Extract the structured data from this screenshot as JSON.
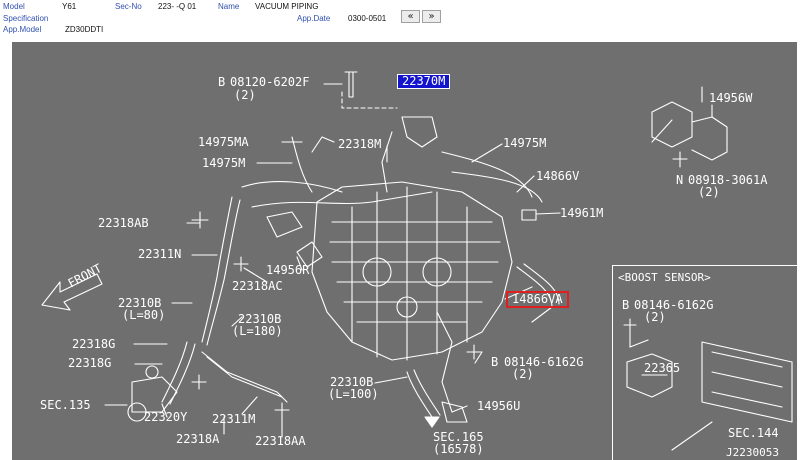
{
  "header": {
    "model_label": "Model",
    "model_value": "Y61",
    "secno_label": "Sec-No",
    "secno_value": "223-   -Q 01",
    "name_label": "Name",
    "name_value": "VACUUM PIPING",
    "spec_label": "Specification",
    "appdate_label": "App.Date",
    "appdate_value": "0300-0501",
    "appmodel_label": "App.Model",
    "appmodel_value": "ZD30DDTI",
    "prev_label": "«",
    "next_label": "»"
  },
  "diagram": {
    "labels": {
      "bolt_08120": "08120-6202F",
      "bolt_08120_qty": "(2)",
      "p22370m": "22370M",
      "p14975ma": "14975MA",
      "p22318m": "22318M",
      "p14975m_a": "14975M",
      "p14975m_b": "14975M",
      "p14866v": "14866V",
      "p14956w": "14956W",
      "nut_08918": "08918-3061A",
      "nut_08918_qty": "(2)",
      "p22318ab": "22318AB",
      "p14961m": "14961M",
      "p22311n": "22311N",
      "p14956r": "14956R",
      "p22318ac": "22318AC",
      "front": "FRONT",
      "p22310b_a": "22310B",
      "p22310b_a_len": "(L=80)",
      "p22310b_b": "22310B",
      "p22310b_b_len": "(L=180)",
      "p14866va": "14866VA",
      "boost_title": "<BOOST SENSOR>",
      "bolt_08146_a": "08146-6162G",
      "bolt_08146_a_qty": "(2)",
      "p22318g_a": "22318G",
      "p22318g_b": "22318G",
      "bolt_08146_b": "08146-6162G",
      "bolt_08146_b_qty": "(2)",
      "p22365": "22365",
      "p22310b_c": "22310B",
      "p22310b_c_len": "(L=100)",
      "sec135": "SEC.135",
      "p22320y": "22320Y",
      "p22311m": "22311M",
      "p14956u": "14956U",
      "p22318a": "22318A",
      "p22318aa": "22318AA",
      "sec165": "SEC.165",
      "sec165_ref": "(16578)",
      "sec144": "SEC.144",
      "drawing_no": "J2230053",
      "circle_b": "B",
      "circle_n": "N"
    }
  },
  "colors": {
    "sheet_bg": "#6f6f6f",
    "line": "#ffffff",
    "highlight_blue": "#1414cc",
    "highlight_red": "#e02020",
    "header_label": "#3050b0"
  }
}
